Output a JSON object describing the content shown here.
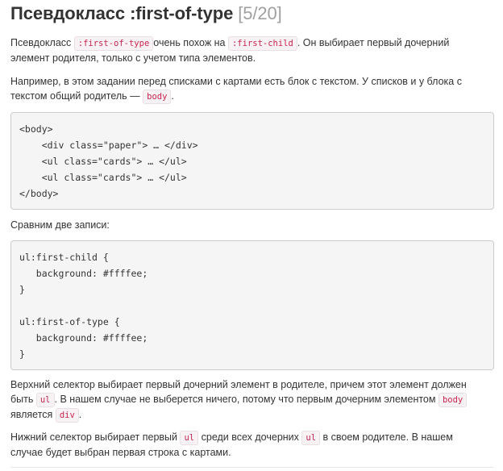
{
  "header": {
    "title": "Псевдокласс :first-of-type",
    "progress": "[5/20]"
  },
  "p1": {
    "a": "Псевдокласс ",
    "code1": ":first-of-type",
    "b": "очень похож на ",
    "code2": ":first-child",
    "c": ". Он выбирает первый дочерний",
    "line2": "элемент родителя, только с учетом типа элементов."
  },
  "p2": {
    "line1": "Например, в этом задании перед списками с картами есть блок с текстом. У списков и у блока с",
    "a": "текстом общий родитель — ",
    "code1": "body",
    "b": "."
  },
  "code_block_1": "<body>\n    <div class=\"paper\"> … </div>\n    <ul class=\"cards\"> … </ul>\n    <ul class=\"cards\"> … </ul>\n</body>",
  "p3": "Сравним две записи:",
  "code_block_2": "ul:first-child {\n   background: #ffffee;\n}\n\nul:first-of-type {\n   background: #ffffee;\n}",
  "p4": {
    "line1": "Верхний селектор выбирает первый дочерний элемент в родителе, причем этот элемент должен",
    "a": "быть ",
    "code1": "ul",
    "b": ". В нашем случае не выберется ничего, потому что первым дочерним элементом ",
    "code2": "body",
    "c": "является ",
    "code3": "div",
    "d": "."
  },
  "p5": {
    "a": "Нижний селектор выбирает первый ",
    "code1": "ul",
    "b": " среди всех дочерних ",
    "code2": "ul",
    "c": " в своем родителе. В нашем",
    "line2": "случае будет выбран первая строка с картами."
  }
}
